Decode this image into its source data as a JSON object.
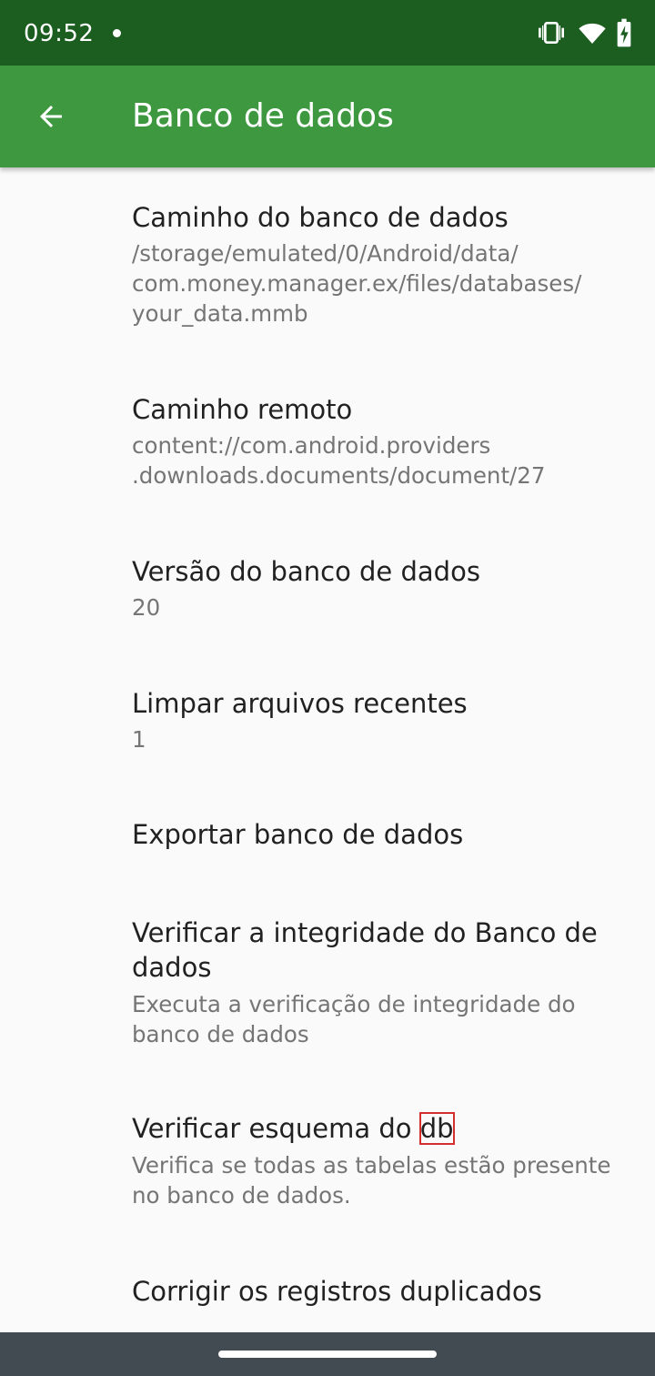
{
  "status_bar": {
    "time": "09:52",
    "icons": [
      "vibrate-icon",
      "wifi-icon",
      "battery-charging-icon"
    ]
  },
  "app_bar": {
    "title": "Banco de dados",
    "back_icon": "arrow-back-icon",
    "background_color": "#3d9840"
  },
  "preferences": [
    {
      "title": "Caminho do banco de dados",
      "summary_lines": [
        "/storage/emulated/0/Android/data/",
        "com.money.manager.ex/files/databases/",
        "your_data.mmb"
      ]
    },
    {
      "title": "Caminho remoto",
      "summary_lines": [
        "content://com.android.providers",
        ".downloads.documents/document/27"
      ]
    },
    {
      "title": "Versão do banco de dados",
      "summary_lines": [
        "20"
      ]
    },
    {
      "title": "Limpar arquivos recentes",
      "summary_lines": [
        "1"
      ]
    },
    {
      "title": "Exportar banco de dados",
      "summary_lines": []
    },
    {
      "title_lines": [
        "Verificar a integridade do Banco de",
        "dados"
      ],
      "summary_lines": [
        "Executa a verificação de integridade do",
        "banco de dados"
      ]
    },
    {
      "title_prefix": "Verificar esquema do ",
      "title_highlight": "db",
      "summary_lines": [
        "Verifica se todas as tabelas estão presente",
        "no banco de dados."
      ]
    },
    {
      "title": "Corrigir os registros duplicados",
      "summary_lines": []
    }
  ],
  "colors": {
    "status_bar": "#1b5e20",
    "app_bar": "#3d9840",
    "title_text": "#212121",
    "summary_text": "#757575",
    "nav_bar": "#424a52"
  }
}
